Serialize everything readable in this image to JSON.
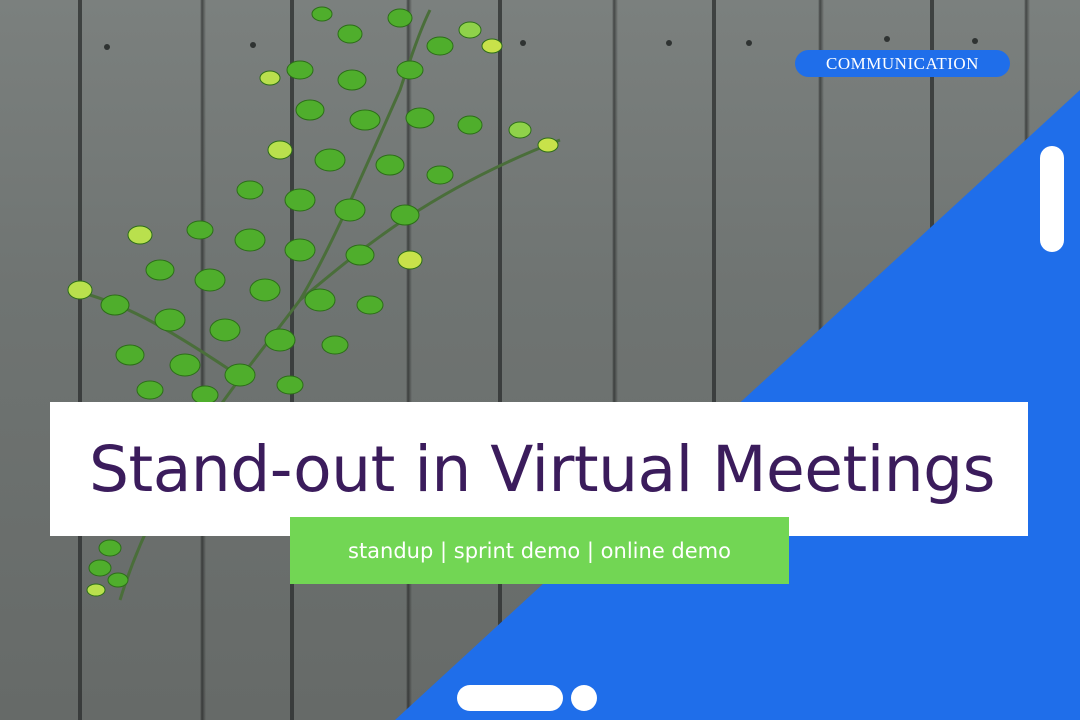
{
  "tag": {
    "label": "COMMUNICATION"
  },
  "title": "Stand-out in Virtual Meetings",
  "subtitle": "standup | sprint demo | online demo",
  "colors": {
    "accent_blue": "#1f6eea",
    "title_purple": "#3b1c5c",
    "subtitle_green": "#72d654",
    "fence_gray": "#6f7472"
  }
}
